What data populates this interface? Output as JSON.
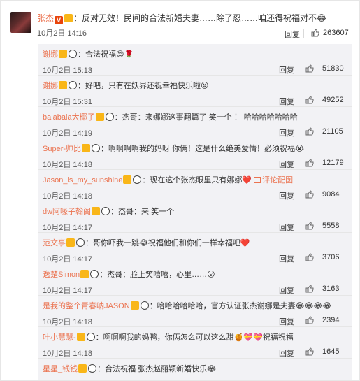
{
  "main_comment": {
    "user": "张杰",
    "text": "：反对无效！民间的合法新婚夫妻……除了忍……咱还得祝福对不😂",
    "time": "10月2日 14:16",
    "reply_label": "回复",
    "likes": "263607"
  },
  "replies": [
    {
      "user": "谢娜",
      "text": "：合法祝福😌🌹",
      "time": "10月2日 15:13",
      "reply_label": "回复",
      "likes": "51830"
    },
    {
      "user": "谢娜",
      "text": "：好吧，只有在妖界还祝幸福快乐啦😝",
      "time": "10月2日 15:31",
      "reply_label": "回复",
      "likes": "49252"
    },
    {
      "user": "balabala大椰子",
      "text": "：杰哥：来娜娜这事翻篇了 笑一个 ！ 哈哈哈哈哈哈哈",
      "time": "10月2日 14:19",
      "reply_label": "回复",
      "likes": "21105"
    },
    {
      "user": "Super-帅比",
      "text": "：啊啊啊啊我的妈呀 你俩！这是什么绝美爱情！必须祝福😭",
      "time": "10月2日 14:18",
      "reply_label": "回复",
      "likes": "12179"
    },
    {
      "user": "Jason_is_my_sunshine",
      "text": "：现在这个张杰眼里只有娜娜❤️",
      "link": "评论配图",
      "time": "10月2日 14:18",
      "reply_label": "回复",
      "likes": "9084"
    },
    {
      "user": "dw阿喙子翰阁",
      "text": "：杰哥：来 笑一个",
      "time": "10月2日 14:17",
      "reply_label": "回复",
      "likes": "5558"
    },
    {
      "user": "范文亭",
      "text": "：哥你吓我一跳😂祝福他们和你们一样幸福吧❤️",
      "time": "10月2日 14:17",
      "reply_label": "回复",
      "likes": "3706"
    },
    {
      "user": "逸楚Simon",
      "text": "：杰哥：脸上笑嘻嘻，心里……😮",
      "time": "10月2日 14:17",
      "reply_label": "回复",
      "likes": "3163"
    },
    {
      "user": "是我的整个青春呐JASON",
      "text": "：哈哈哈哈哈哈，官方认证张杰谢娜是夫妻😂😂😂😂",
      "time": "10月2日 14:18",
      "reply_label": "回复",
      "likes": "2394"
    },
    {
      "user": "叶小慧慧-",
      "text": "：啊啊啊我的妈鸭，你俩怎么可以这么甜🍯💝💝祝福祝福",
      "time": "10月2日 14:18",
      "reply_label": "回复",
      "likes": "1645"
    },
    {
      "user": "星星_钱钱",
      "text": "：合法祝福 张杰赵丽颖新婚快乐😂",
      "time": "",
      "reply_label": "",
      "likes": ""
    }
  ],
  "colors": {
    "username": "#eb7350",
    "verified": "#e8440c",
    "vip": "#f9b618",
    "reply_bg": "#f2f2f5"
  }
}
